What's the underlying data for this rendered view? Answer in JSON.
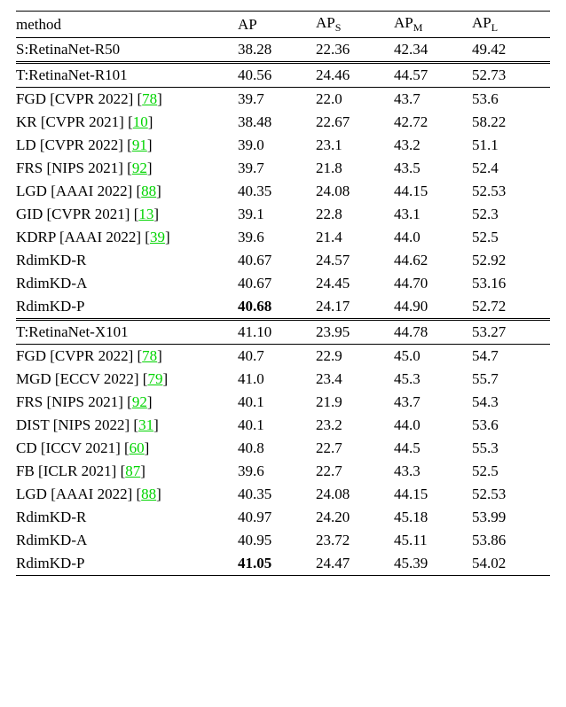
{
  "header": {
    "method": "method",
    "ap": "AP",
    "aps_prefix": "AP",
    "aps_sub": "S",
    "apm_prefix": "AP",
    "apm_sub": "M",
    "apl_prefix": "AP",
    "apl_sub": "L"
  },
  "chart_data": {
    "type": "table",
    "columns": [
      "method",
      "AP",
      "AP_S",
      "AP_M",
      "AP_L"
    ],
    "student": {
      "method": "S:RetinaNet-R50",
      "AP": "38.28",
      "AP_S": "22.36",
      "AP_M": "42.34",
      "AP_L": "49.42"
    },
    "blocks": [
      {
        "teacher": {
          "method": "T:RetinaNet-R101",
          "AP": "40.56",
          "AP_S": "24.46",
          "AP_M": "44.57",
          "AP_L": "52.73"
        },
        "rows": [
          {
            "method_pre": "FGD [CVPR 2022] [",
            "ref": "78",
            "method_post": "]",
            "AP": "39.7",
            "AP_S": "22.0",
            "AP_M": "43.7",
            "AP_L": "53.6"
          },
          {
            "method_pre": "KR [CVPR 2021] [",
            "ref": "10",
            "method_post": "]",
            "AP": "38.48",
            "AP_S": "22.67",
            "AP_M": "42.72",
            "AP_L": "58.22"
          },
          {
            "method_pre": "LD [CVPR 2022] [",
            "ref": "91",
            "method_post": "]",
            "AP": "39.0",
            "AP_S": "23.1",
            "AP_M": "43.2",
            "AP_L": "51.1"
          },
          {
            "method_pre": "FRS [NIPS 2021] [",
            "ref": "92",
            "method_post": "]",
            "AP": "39.7",
            "AP_S": "21.8",
            "AP_M": "43.5",
            "AP_L": "52.4"
          },
          {
            "method_pre": "LGD [AAAI 2022] [",
            "ref": "88",
            "method_post": "]",
            "AP": "40.35",
            "AP_S": "24.08",
            "AP_M": "44.15",
            "AP_L": "52.53"
          },
          {
            "method_pre": "GID [CVPR 2021] [",
            "ref": "13",
            "method_post": "]",
            "AP": "39.1",
            "AP_S": "22.8",
            "AP_M": "43.1",
            "AP_L": "52.3"
          },
          {
            "method_pre": "KDRP [AAAI 2022] [",
            "ref": "39",
            "method_post": "]",
            "AP": "39.6",
            "AP_S": "21.4",
            "AP_M": "44.0",
            "AP_L": "52.5"
          },
          {
            "method_pre": "RdimKD-R",
            "ref": "",
            "method_post": "",
            "AP": "40.67",
            "AP_S": "24.57",
            "AP_M": "44.62",
            "AP_L": "52.92"
          },
          {
            "method_pre": "RdimKD-A",
            "ref": "",
            "method_post": "",
            "AP": "40.67",
            "AP_S": "24.45",
            "AP_M": "44.70",
            "AP_L": "53.16"
          },
          {
            "method_pre": "RdimKD-P",
            "ref": "",
            "method_post": "",
            "AP": "40.68",
            "AP_bold": true,
            "AP_S": "24.17",
            "AP_M": "44.90",
            "AP_L": "52.72"
          }
        ]
      },
      {
        "teacher": {
          "method": "T:RetinaNet-X101",
          "AP": "41.10",
          "AP_S": "23.95",
          "AP_M": "44.78",
          "AP_L": "53.27"
        },
        "rows": [
          {
            "method_pre": "FGD [CVPR 2022] [",
            "ref": "78",
            "method_post": "]",
            "AP": "40.7",
            "AP_S": "22.9",
            "AP_M": "45.0",
            "AP_L": "54.7"
          },
          {
            "method_pre": "MGD [ECCV 2022] [",
            "ref": "79",
            "method_post": "]",
            "AP": "41.0",
            "AP_S": "23.4",
            "AP_M": "45.3",
            "AP_L": "55.7"
          },
          {
            "method_pre": "FRS [NIPS 2021] [",
            "ref": "92",
            "method_post": "]",
            "AP": "40.1",
            "AP_S": "21.9",
            "AP_M": "43.7",
            "AP_L": "54.3"
          },
          {
            "method_pre": "DIST [NIPS 2022] [",
            "ref": "31",
            "method_post": "]",
            "AP": "40.1",
            "AP_S": "23.2",
            "AP_M": "44.0",
            "AP_L": "53.6"
          },
          {
            "method_pre": "CD [ICCV 2021] [",
            "ref": "60",
            "method_post": "]",
            "AP": "40.8",
            "AP_S": "22.7",
            "AP_M": "44.5",
            "AP_L": "55.3"
          },
          {
            "method_pre": "FB [ICLR 2021] [",
            "ref": "87",
            "method_post": "]",
            "AP": "39.6",
            "AP_S": "22.7",
            "AP_M": "43.3",
            "AP_L": "52.5"
          },
          {
            "method_pre": "LGD [AAAI 2022] [",
            "ref": "88",
            "method_post": "]",
            "AP": "40.35",
            "AP_S": "24.08",
            "AP_M": "44.15",
            "AP_L": "52.53"
          },
          {
            "method_pre": "RdimKD-R",
            "ref": "",
            "method_post": "",
            "AP": "40.97",
            "AP_S": "24.20",
            "AP_M": "45.18",
            "AP_L": "53.99"
          },
          {
            "method_pre": "RdimKD-A",
            "ref": "",
            "method_post": "",
            "AP": "40.95",
            "AP_S": "23.72",
            "AP_M": "45.11",
            "AP_L": "53.86"
          },
          {
            "method_pre": "RdimKD-P",
            "ref": "",
            "method_post": "",
            "AP": "41.05",
            "AP_bold": true,
            "AP_S": "24.47",
            "AP_M": "45.39",
            "AP_L": "54.02"
          }
        ]
      }
    ]
  }
}
